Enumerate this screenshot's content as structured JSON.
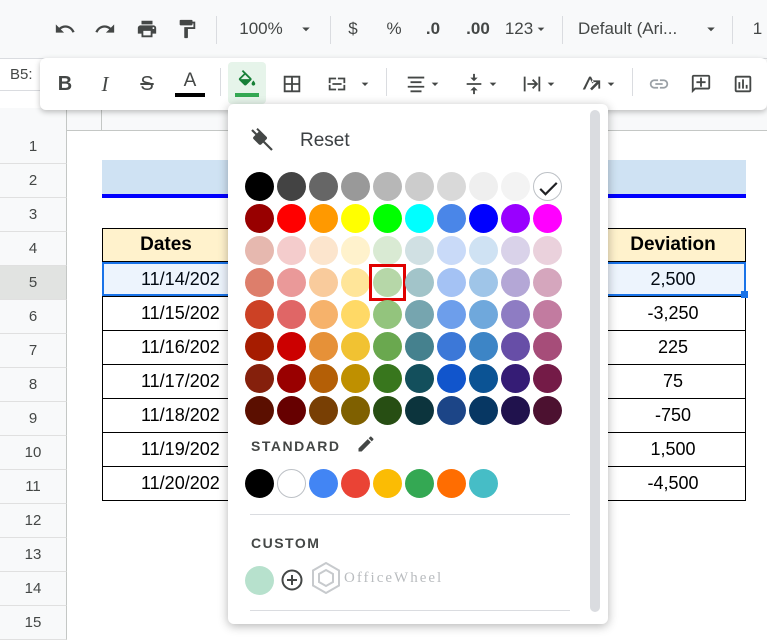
{
  "toolbar": {
    "zoom": "100%",
    "currency": "$",
    "percent": "%",
    "decrease_decimal": ".0",
    "increase_decimal": ".00",
    "more_formats": "123",
    "font": "Default (Ari...",
    "font_size_partial": "1"
  },
  "sheet": {
    "name_box": "B5:",
    "row_numbers": [
      "1",
      "2",
      "3",
      "4",
      "5",
      "6",
      "7",
      "8",
      "9",
      "10",
      "11",
      "12",
      "13",
      "14",
      "15"
    ],
    "header_left": "Dates",
    "header_right": "Deviation",
    "dates": [
      "11/14/202",
      "11/15/202",
      "11/16/202",
      "11/17/202",
      "11/18/202",
      "11/19/202",
      "11/20/202"
    ],
    "deviations": [
      "2,500",
      "-3,250",
      "225",
      "75",
      "-750",
      "1,500",
      "-4,500"
    ],
    "colors": {
      "header_fill": "#fff2cc",
      "title_bar": "#cfe2f3",
      "title_underline": "#0000ff",
      "selection": "#1a73e8"
    }
  },
  "palette": {
    "reset_label": "Reset",
    "standard_label": "STANDARD",
    "custom_label": "CUSTOM",
    "rows": [
      [
        "#000000",
        "#434343",
        "#666666",
        "#999999",
        "#b7b7b7",
        "#cccccc",
        "#d9d9d9",
        "#efefef",
        "#f3f3f3",
        "#ffffff"
      ],
      [
        "#980000",
        "#ff0000",
        "#ff9900",
        "#ffff00",
        "#00ff00",
        "#00ffff",
        "#4a86e8",
        "#0000ff",
        "#9900ff",
        "#ff00ff"
      ],
      [
        "#e6b8af",
        "#f4cccc",
        "#fce5cd",
        "#fff2cc",
        "#d9ead3",
        "#d0e0e3",
        "#c9daf8",
        "#cfe2f3",
        "#d9d2e9",
        "#ead1dc"
      ],
      [
        "#dd7e6b",
        "#ea9999",
        "#f9cb9c",
        "#ffe599",
        "#b6d7a8",
        "#a2c4c9",
        "#a4c2f4",
        "#9fc5e8",
        "#b4a7d6",
        "#d5a6bd"
      ],
      [
        "#cc4125",
        "#e06666",
        "#f6b26b",
        "#ffd966",
        "#93c47d",
        "#76a5af",
        "#6d9eeb",
        "#6fa8dc",
        "#8e7cc3",
        "#c27ba0"
      ],
      [
        "#a61c00",
        "#cc0000",
        "#e69138",
        "#f1c232",
        "#6aa84f",
        "#45818e",
        "#3c78d8",
        "#3d85c6",
        "#674ea7",
        "#a64d79"
      ],
      [
        "#85200c",
        "#990000",
        "#b45f06",
        "#bf9000",
        "#38761d",
        "#134f5c",
        "#1155cc",
        "#0b5394",
        "#351c75",
        "#741b47"
      ],
      [
        "#5b0f00",
        "#660000",
        "#783f04",
        "#7f6000",
        "#274e13",
        "#0c343d",
        "#1c4587",
        "#073763",
        "#20124d",
        "#4c1130"
      ]
    ],
    "standard": [
      "#000000",
      "#ffffff",
      "#4285f4",
      "#ea4335",
      "#fbbc04",
      "#34a853",
      "#ff6d01",
      "#46bdc6"
    ],
    "custom": [
      "#b7e1cd"
    ],
    "highlight_color": "#e00000"
  },
  "watermark": "OfficeWheel"
}
